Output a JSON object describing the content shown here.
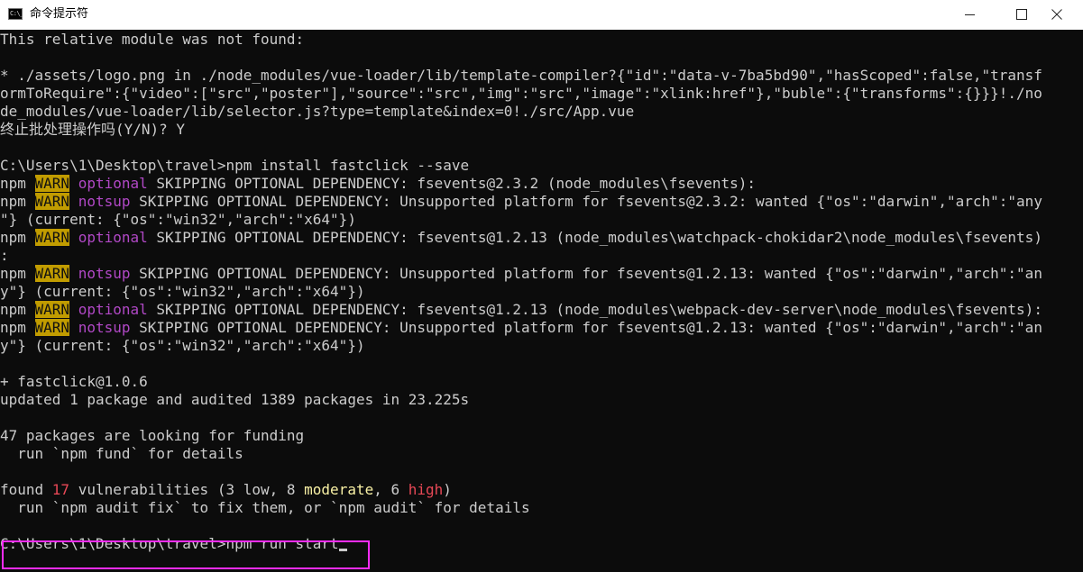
{
  "window": {
    "title": "命令提示符",
    "icon": "cmd-icon",
    "icon_text": "C:\\_"
  },
  "console": {
    "l01": "This relative module was not found:",
    "l02": "",
    "l03": "* ./assets/logo.png in ./node_modules/vue-loader/lib/template-compiler?{\"id\":\"data-v-7ba5bd90\",\"hasScoped\":false,\"transf",
    "l04": "ormToRequire\":{\"video\":[\"src\",\"poster\"],\"source\":\"src\",\"img\":\"src\",\"image\":\"xlink:href\"},\"buble\":{\"transforms\":{}}}!./no",
    "l05": "de_modules/vue-loader/lib/selector.js?type=template&index=0!./src/App.vue",
    "l06": "终止批处理操作吗(Y/N)? Y",
    "l07": "",
    "l08": "C:\\Users\\1\\Desktop\\travel>npm install fastclick --save",
    "w1_pre": "npm ",
    "w1_warn": "WARN",
    "w1_sp": " ",
    "w1_tag": "optional",
    "w1_rest": " SKIPPING OPTIONAL DEPENDENCY: fsevents@2.3.2 (node_modules\\fsevents):",
    "w2_pre": "npm ",
    "w2_warn": "WARN",
    "w2_sp": " ",
    "w2_tag": "notsup",
    "w2_rest": " SKIPPING OPTIONAL DEPENDENCY: Unsupported platform for fsevents@2.3.2: wanted {\"os\":\"darwin\",\"arch\":\"any",
    "l11": "\"} (current: {\"os\":\"win32\",\"arch\":\"x64\"})",
    "w3_pre": "npm ",
    "w3_warn": "WARN",
    "w3_sp": " ",
    "w3_tag": "optional",
    "w3_rest": " SKIPPING OPTIONAL DEPENDENCY: fsevents@1.2.13 (node_modules\\watchpack-chokidar2\\node_modules\\fsevents)",
    "l13": ":",
    "w4_pre": "npm ",
    "w4_warn": "WARN",
    "w4_sp": " ",
    "w4_tag": "notsup",
    "w4_rest": " SKIPPING OPTIONAL DEPENDENCY: Unsupported platform for fsevents@1.2.13: wanted {\"os\":\"darwin\",\"arch\":\"an",
    "l15": "y\"} (current: {\"os\":\"win32\",\"arch\":\"x64\"})",
    "w5_pre": "npm ",
    "w5_warn": "WARN",
    "w5_sp": " ",
    "w5_tag": "optional",
    "w5_rest": " SKIPPING OPTIONAL DEPENDENCY: fsevents@1.2.13 (node_modules\\webpack-dev-server\\node_modules\\fsevents):",
    "w6_pre": "npm ",
    "w6_warn": "WARN",
    "w6_sp": " ",
    "w6_tag": "notsup",
    "w6_rest": " SKIPPING OPTIONAL DEPENDENCY: Unsupported platform for fsevents@1.2.13: wanted {\"os\":\"darwin\",\"arch\":\"an",
    "l18": "y\"} (current: {\"os\":\"win32\",\"arch\":\"x64\"})",
    "l19": "",
    "l20": "+ fastclick@1.0.6",
    "l21": "updated 1 package and audited 1389 packages in 23.225s",
    "l22": "",
    "l23": "47 packages are looking for funding",
    "l24": "  run `npm fund` for details",
    "l25": "",
    "v_pre": "found ",
    "v_count": "17",
    "v_mid1": " vulnerabilities (3 low, 8 ",
    "v_moderate": "moderate",
    "v_mid2": ", 6 ",
    "v_high": "high",
    "v_end": ")",
    "l27": "  run `npm audit fix` to fix them, or `npm audit` for details",
    "l28": "",
    "prompt": "C:\\Users\\1\\Desktop\\travel>npm run start"
  },
  "colors": {
    "background": "#0c0c0c",
    "text": "#cccccc",
    "warn_bg": "#c19c00",
    "magenta": "#b148c6",
    "red": "#e74856",
    "yellow": "#f9f1a5",
    "highlight": "#ff2cff"
  }
}
